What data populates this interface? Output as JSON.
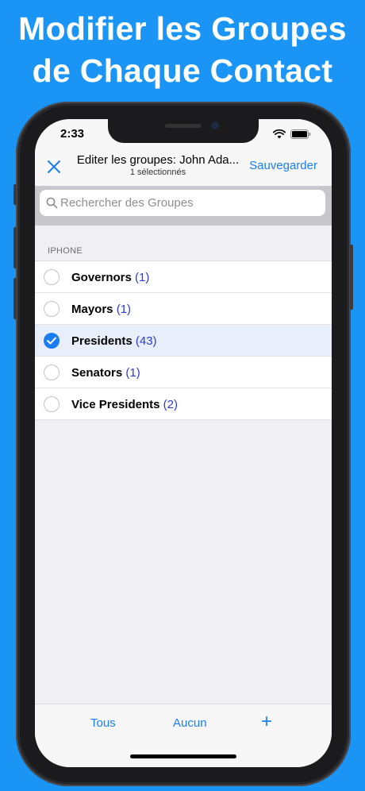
{
  "headline": {
    "line1": "Modifier les Groupes",
    "line2": "de Chaque Contact"
  },
  "status": {
    "time": "2:33"
  },
  "nav": {
    "title": "Editer les groupes: John Ada...",
    "subtitle": "1 sélectionnés",
    "save_label": "Sauvegarder"
  },
  "search": {
    "placeholder": "Rechercher des Groupes"
  },
  "section": {
    "title": "IPHONE"
  },
  "groups": [
    {
      "name": "Governors",
      "count": "(1)",
      "selected": false
    },
    {
      "name": "Mayors",
      "count": "(1)",
      "selected": false
    },
    {
      "name": "Presidents",
      "count": "(43)",
      "selected": true
    },
    {
      "name": "Senators",
      "count": "(1)",
      "selected": false
    },
    {
      "name": "Vice Presidents",
      "count": "(2)",
      "selected": false
    }
  ],
  "toolbar": {
    "all_label": "Tous",
    "none_label": "Aucun",
    "add_label": "+"
  },
  "colors": {
    "background": "#1a95f5",
    "accent": "#1a7ef2",
    "count": "#2b3ad6"
  }
}
